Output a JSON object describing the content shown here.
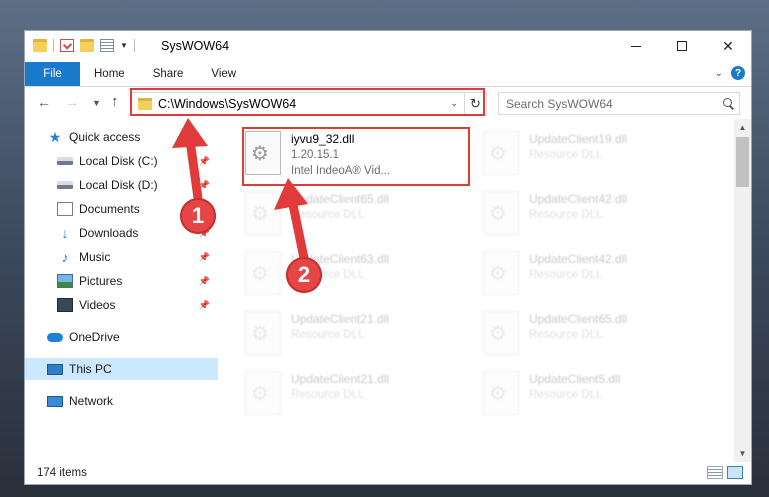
{
  "window": {
    "title": "SysWOW64",
    "controls": {
      "minimize": "",
      "maximize": "",
      "close": "✕"
    }
  },
  "ribbon": {
    "tabs": [
      "File",
      "Home",
      "Share",
      "View"
    ],
    "help": "?"
  },
  "address": {
    "path": "C:\\Windows\\SysWOW64",
    "search_placeholder": "Search SysWOW64"
  },
  "navpane": {
    "items": [
      {
        "label": "Quick access",
        "icon": "star-icon"
      },
      {
        "label": "Local Disk (C:)",
        "icon": "disk-icon",
        "pinned": true
      },
      {
        "label": "Local Disk (D:)",
        "icon": "disk-icon",
        "pinned": true
      },
      {
        "label": "Documents",
        "icon": "documents-icon",
        "pinned": true
      },
      {
        "label": "Downloads",
        "icon": "download-icon",
        "pinned": true
      },
      {
        "label": "Music",
        "icon": "music-icon",
        "pinned": true
      },
      {
        "label": "Pictures",
        "icon": "pictures-icon",
        "pinned": true
      },
      {
        "label": "Videos",
        "icon": "videos-icon",
        "pinned": true
      },
      {
        "label": "OneDrive",
        "icon": "cloud-icon"
      },
      {
        "label": "This PC",
        "icon": "pc-icon",
        "selected": true
      },
      {
        "label": "Network",
        "icon": "network-icon"
      }
    ]
  },
  "files": {
    "highlighted": {
      "name": "iyvu9_32.dll",
      "version": "1.20.15.1",
      "description": "Intel IndeoA® Vid..."
    },
    "faded": [
      {
        "name": "UpdateClient19.dll",
        "type": "Resource DLL"
      },
      {
        "name": "UpdateClient65.dll",
        "type": "Resource DLL"
      },
      {
        "name": "UpdateClient42.dll",
        "type": "Resource DLL"
      },
      {
        "name": "UpdateClient63.dll",
        "type": "Resource DLL"
      },
      {
        "name": "UpdateClient42.dll",
        "type": "Resource DLL"
      },
      {
        "name": "UpdateClient21.dll",
        "type": "Resource DLL"
      },
      {
        "name": "UpdateClient65.dll",
        "type": "Resource DLL"
      },
      {
        "name": "UpdateClient21.dll",
        "type": "Resource DLL"
      },
      {
        "name": "UpdateClient5.dll",
        "type": "Resource DLL"
      }
    ]
  },
  "status": {
    "item_count": "174 items"
  },
  "annotations": {
    "step1": "1",
    "step2": "2",
    "color": "#e03a3a"
  }
}
